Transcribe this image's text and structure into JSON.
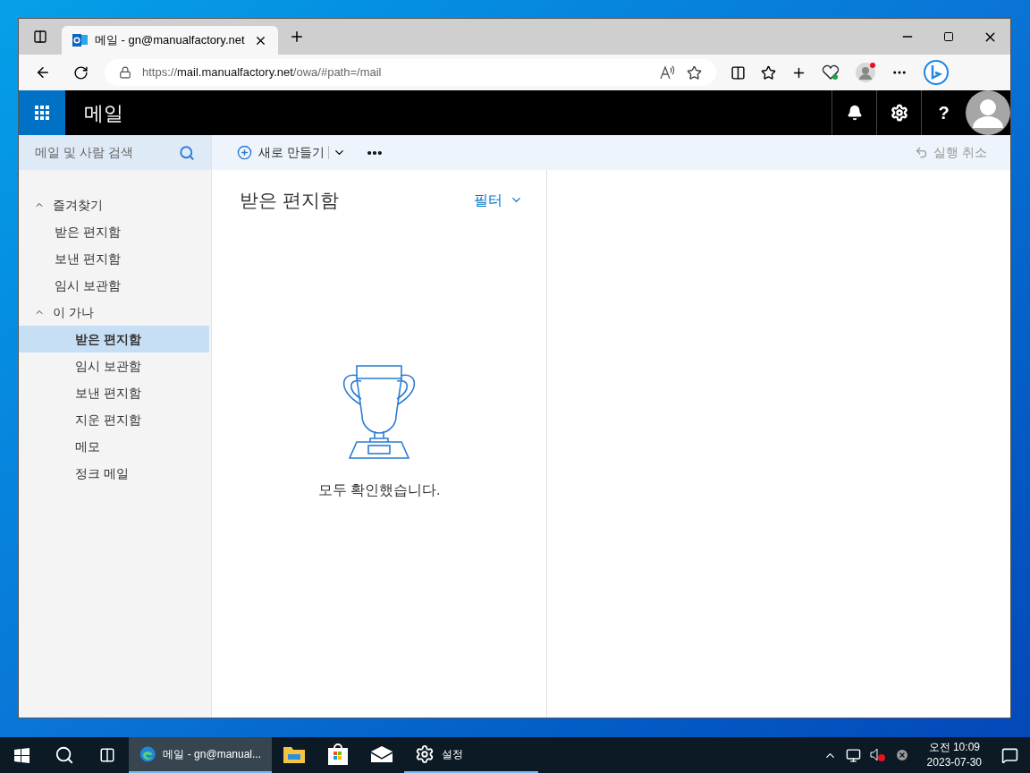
{
  "browser": {
    "tabs": [
      {
        "title": "메일 - gn@manualfactory.net",
        "selected": true
      }
    ],
    "url": {
      "scheme": "https://",
      "host": "mail.manualfactory.net",
      "path": "/owa/#path=/mail"
    }
  },
  "app": {
    "title": "메일",
    "help_glyph": "?",
    "search": {
      "placeholder": "메일 및 사람 검색"
    },
    "toolbar": {
      "new_label": "새로 만들기",
      "undo": {
        "label": "실행 취소",
        "disabled": true
      }
    },
    "folder_groups": [
      {
        "label": "즐겨찾기",
        "expanded": true,
        "items": [
          {
            "label": "받은 편지함",
            "selected": false
          },
          {
            "label": "보낸 편지함",
            "selected": false
          },
          {
            "label": "임시 보관함",
            "selected": false
          }
        ]
      },
      {
        "label": "이 가나",
        "expanded": true,
        "items": [
          {
            "label": "받은 편지함",
            "selected": true
          },
          {
            "label": "임시 보관함",
            "selected": false
          },
          {
            "label": "보낸 편지함",
            "selected": false
          },
          {
            "label": "지운 편지함",
            "selected": false
          },
          {
            "label": "메모",
            "selected": false
          },
          {
            "label": "정크 메일",
            "selected": false
          }
        ]
      }
    ],
    "list": {
      "title": "받은 편지함",
      "filter": "필터",
      "empty_message": "모두 확인했습니다."
    }
  },
  "taskbar": {
    "apps": [
      {
        "kind": "edge",
        "label": "메일 - gn@manual...",
        "running": true,
        "active": true
      },
      {
        "kind": "explorer",
        "running": false,
        "active": false
      },
      {
        "kind": "store",
        "running": false,
        "active": false
      },
      {
        "kind": "mail",
        "running": false,
        "active": false
      },
      {
        "kind": "settings",
        "label": "설정",
        "running": true,
        "active": false
      }
    ],
    "clock": {
      "time": "오전 10:09",
      "date": "2023-07-30"
    }
  }
}
